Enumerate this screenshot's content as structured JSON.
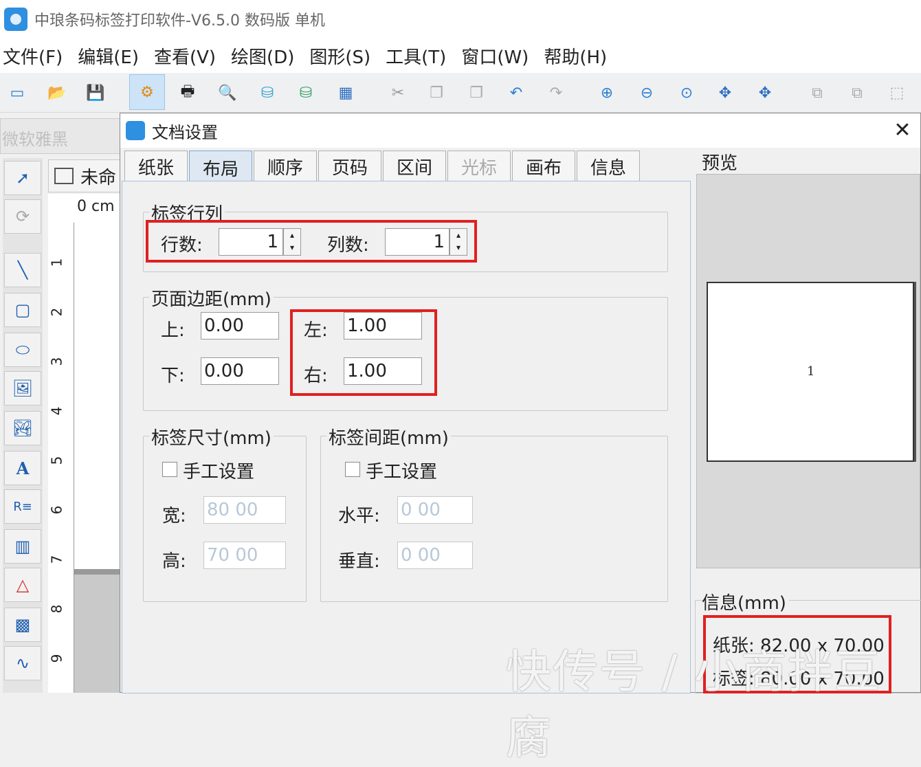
{
  "app": {
    "title": "中琅条码标签打印软件-V6.5.0 数码版 单机"
  },
  "menu": [
    "文件(F)",
    "编辑(E)",
    "查看(V)",
    "绘图(D)",
    "图形(S)",
    "工具(T)",
    "窗口(W)",
    "帮助(H)"
  ],
  "font_box": "微软雅黑",
  "doc_tab": "未命",
  "ruler": {
    "unit": "0 cm",
    "marks": [
      "1",
      "2",
      "3",
      "4",
      "5",
      "6",
      "7",
      "8",
      "9"
    ]
  },
  "dialog": {
    "title": "文档设置",
    "close": "✕",
    "tabs": [
      "纸张",
      "布局",
      "顺序",
      "页码",
      "区间",
      "光标",
      "画布",
      "信息"
    ],
    "layout": {
      "rows_cols_title": "标签行列",
      "rows_label": "行数:",
      "rows_value": "1",
      "cols_label": "列数:",
      "cols_value": "1",
      "margin_title": "页面边距(mm)",
      "top_label": "上:",
      "top_value": "0.00",
      "bottom_label": "下:",
      "bottom_value": "0.00",
      "left_label": "左:",
      "left_value": "1.00",
      "right_label": "右:",
      "right_value": "1.00",
      "size_title": "标签尺寸(mm)",
      "size_manual": "手工设置",
      "width_label": "宽:",
      "width_value": "80 00",
      "height_label": "高:",
      "height_value": "70 00",
      "gap_title": "标签间距(mm)",
      "gap_manual": "手工设置",
      "h_label": "水平:",
      "h_value": "0 00",
      "v_label": "垂直:",
      "v_value": "0 00"
    },
    "preview": {
      "title": "预览",
      "page_number": "1"
    },
    "info": {
      "title": "信息(mm)",
      "paper": "纸张: 82.00 x 70.00",
      "label": "标签: 80.00 x 70.00"
    }
  },
  "watermark": "快传号 / 小商拌豆腐"
}
